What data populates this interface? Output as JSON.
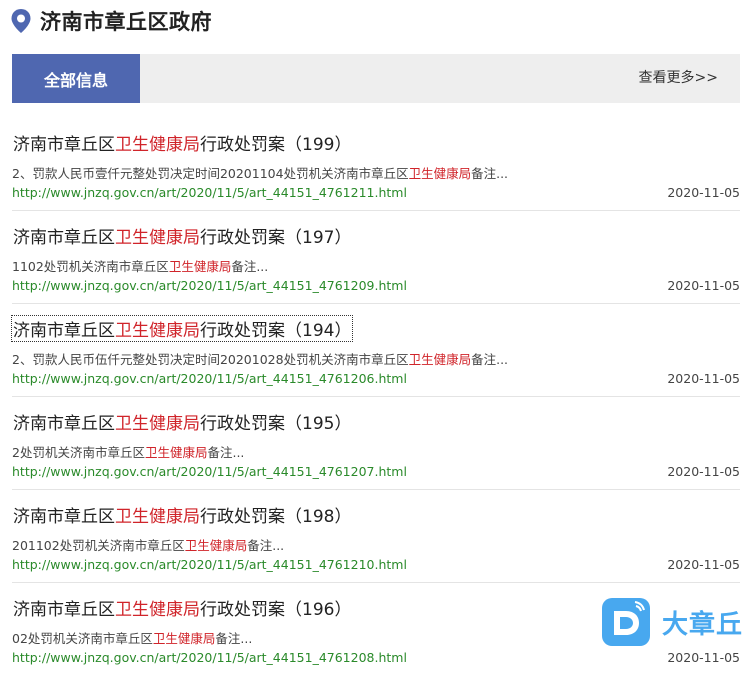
{
  "header": {
    "title": "济南市章丘区政府"
  },
  "tabs": {
    "active_label": "全部信息",
    "more_label": "查看更多>>"
  },
  "results": [
    {
      "title_pre": "济南市章丘区",
      "title_hl": "卫生健康局",
      "title_post": "行政处罚案（199）",
      "snippet_pre": "2、罚款人民币壹仟元整处罚决定时间20201104处罚机关济南市章丘区",
      "snippet_hl": "卫生健康局",
      "snippet_post": "备注...",
      "url": "http://www.jnzq.gov.cn/art/2020/11/5/art_44151_4761211.html",
      "date": "2020-11-05"
    },
    {
      "title_pre": "济南市章丘区",
      "title_hl": "卫生健康局",
      "title_post": "行政处罚案（197）",
      "snippet_pre": "1102处罚机关济南市章丘区",
      "snippet_hl": "卫生健康局",
      "snippet_post": "备注...",
      "url": "http://www.jnzq.gov.cn/art/2020/11/5/art_44151_4761209.html",
      "date": "2020-11-05"
    },
    {
      "title_pre": "济南市章丘区",
      "title_hl": "卫生健康局",
      "title_post": "行政处罚案（194）",
      "snippet_pre": "2、罚款人民币伍仟元整处罚决定时间20201028处罚机关济南市章丘区",
      "snippet_hl": "卫生健康局",
      "snippet_post": "备注...",
      "url": "http://www.jnzq.gov.cn/art/2020/11/5/art_44151_4761206.html",
      "date": "2020-11-05"
    },
    {
      "title_pre": "济南市章丘区",
      "title_hl": "卫生健康局",
      "title_post": "行政处罚案（195）",
      "snippet_pre": "2处罚机关济南市章丘区",
      "snippet_hl": "卫生健康局",
      "snippet_post": "备注...",
      "url": "http://www.jnzq.gov.cn/art/2020/11/5/art_44151_4761207.html",
      "date": "2020-11-05"
    },
    {
      "title_pre": "济南市章丘区",
      "title_hl": "卫生健康局",
      "title_post": "行政处罚案（198）",
      "snippet_pre": "201102处罚机关济南市章丘区",
      "snippet_hl": "卫生健康局",
      "snippet_post": "备注...",
      "url": "http://www.jnzq.gov.cn/art/2020/11/5/art_44151_4761210.html",
      "date": "2020-11-05"
    },
    {
      "title_pre": "济南市章丘区",
      "title_hl": "卫生健康局",
      "title_post": "行政处罚案（196）",
      "snippet_pre": "02处罚机关济南市章丘区",
      "snippet_hl": "卫生健康局",
      "snippet_post": "备注...",
      "url": "http://www.jnzq.gov.cn/art/2020/11/5/art_44151_4761208.html",
      "date": "2020-11-05"
    }
  ],
  "watermark": {
    "text": "大章丘",
    "icon": "d-logo-icon"
  },
  "colors": {
    "accent": "#4f67b0",
    "highlight": "#d0242a",
    "url": "#2a8a2a",
    "watermark": "#48a8ef"
  }
}
